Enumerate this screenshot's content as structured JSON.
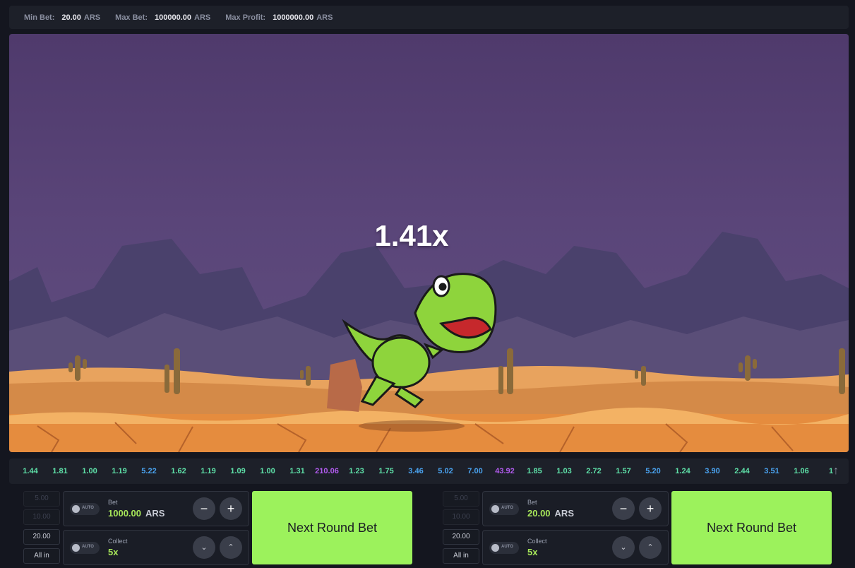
{
  "limits": {
    "min_label": "Min Bet:",
    "min_value": "20.00",
    "min_currency": "ARS",
    "max_label": "Max Bet:",
    "max_value": "100000.00",
    "max_currency": "ARS",
    "profit_label": "Max Profit:",
    "profit_value": "1000000.00",
    "profit_currency": "ARS"
  },
  "game": {
    "multiplier": "1.41x"
  },
  "history": [
    {
      "v": "1.44",
      "c": "#5ee0a8"
    },
    {
      "v": "1.81",
      "c": "#5ee0a8"
    },
    {
      "v": "1.00",
      "c": "#5ee0a8"
    },
    {
      "v": "1.19",
      "c": "#5ee0a8"
    },
    {
      "v": "5.22",
      "c": "#4aa3f0"
    },
    {
      "v": "1.62",
      "c": "#5ee0a8"
    },
    {
      "v": "1.19",
      "c": "#5ee0a8"
    },
    {
      "v": "1.09",
      "c": "#5ee0a8"
    },
    {
      "v": "1.00",
      "c": "#5ee0a8"
    },
    {
      "v": "1.31",
      "c": "#5ee0a8"
    },
    {
      "v": "210.06",
      "c": "#b35cf0"
    },
    {
      "v": "1.23",
      "c": "#5ee0a8"
    },
    {
      "v": "1.75",
      "c": "#5ee0a8"
    },
    {
      "v": "3.46",
      "c": "#4aa3f0"
    },
    {
      "v": "5.02",
      "c": "#4aa3f0"
    },
    {
      "v": "7.00",
      "c": "#4aa3f0"
    },
    {
      "v": "43.92",
      "c": "#b35cf0"
    },
    {
      "v": "1.85",
      "c": "#5ee0a8"
    },
    {
      "v": "1.03",
      "c": "#5ee0a8"
    },
    {
      "v": "2.72",
      "c": "#5ee0a8"
    },
    {
      "v": "1.57",
      "c": "#5ee0a8"
    },
    {
      "v": "5.20",
      "c": "#4aa3f0"
    },
    {
      "v": "1.24",
      "c": "#5ee0a8"
    },
    {
      "v": "3.90",
      "c": "#4aa3f0"
    },
    {
      "v": "2.44",
      "c": "#5ee0a8"
    },
    {
      "v": "3.51",
      "c": "#4aa3f0"
    },
    {
      "v": "1.06",
      "c": "#5ee0a8"
    },
    {
      "v": "1",
      "c": "#5ee0a8"
    }
  ],
  "panels": [
    {
      "quick": [
        "5.00",
        "10.00",
        "20.00",
        "All in"
      ],
      "auto_label": "AUTO",
      "bet_label": "Bet",
      "bet_value": "1000.00",
      "bet_currency": "ARS",
      "minus": "−",
      "plus": "+",
      "collect_label": "Collect",
      "collect_value": "5x",
      "down": "⌄",
      "up": "⌃",
      "button": "Next Round Bet"
    },
    {
      "quick": [
        "5.00",
        "10.00",
        "20.00",
        "All in"
      ],
      "auto_label": "AUTO",
      "bet_label": "Bet",
      "bet_value": "20.00",
      "bet_currency": "ARS",
      "minus": "−",
      "plus": "+",
      "collect_label": "Collect",
      "collect_value": "5x",
      "down": "⌄",
      "up": "⌃",
      "button": "Next Round Bet"
    }
  ],
  "colors": {
    "accent": "#9cf25c",
    "bet_value": "#a8e85a"
  }
}
